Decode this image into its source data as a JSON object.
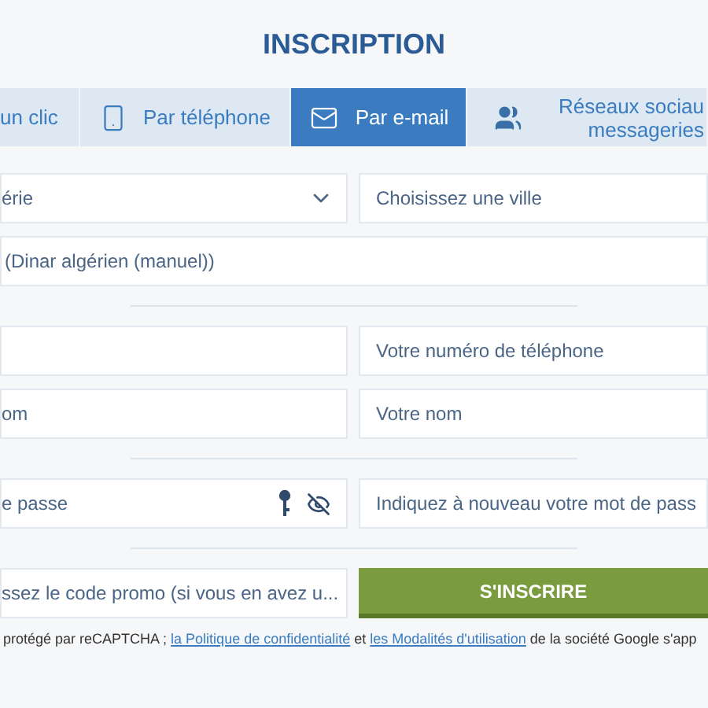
{
  "title": "INSCRIPTION",
  "tabs": [
    {
      "label": "un clic",
      "selected": false
    },
    {
      "label": "Par téléphone",
      "selected": false
    },
    {
      "label": "Par e-mail",
      "selected": true
    },
    {
      "label": "Réseaux sociau",
      "label_2": "messageries",
      "selected": false
    }
  ],
  "groups": [
    [
      {
        "fields": [
          {
            "kind": "select",
            "value": "érie"
          },
          {
            "kind": "text",
            "placeholder": "Choisissez une ville"
          }
        ]
      },
      {
        "fields": [
          {
            "kind": "value",
            "value": "(Dinar algérien (manuel))"
          }
        ]
      }
    ],
    [
      {
        "fields": [
          {
            "kind": "text"
          },
          {
            "kind": "text",
            "placeholder": "Votre numéro de téléphone"
          }
        ]
      },
      {
        "fields": [
          {
            "kind": "text",
            "placeholder": "om"
          },
          {
            "kind": "text",
            "placeholder": "Votre nom"
          }
        ]
      }
    ],
    [
      {
        "fields": [
          {
            "kind": "password",
            "placeholder": "e passe"
          },
          {
            "kind": "text",
            "placeholder": "Indiquez à nouveau votre mot de pass"
          }
        ]
      }
    ],
    [
      {
        "fields": [
          {
            "kind": "text",
            "placeholder": "ssez le code promo (si vous en avez u..."
          },
          {
            "kind": "button",
            "label": "S'INSCRIRE"
          }
        ]
      }
    ]
  ],
  "footer": {
    "text_1": "protégé par reCAPTCHA ; ",
    "link_1": "la Politique de confidentialité",
    "text_2": " et ",
    "link_2": "les Modalités d'utilisation",
    "text_3": " de la société Google s'app"
  }
}
